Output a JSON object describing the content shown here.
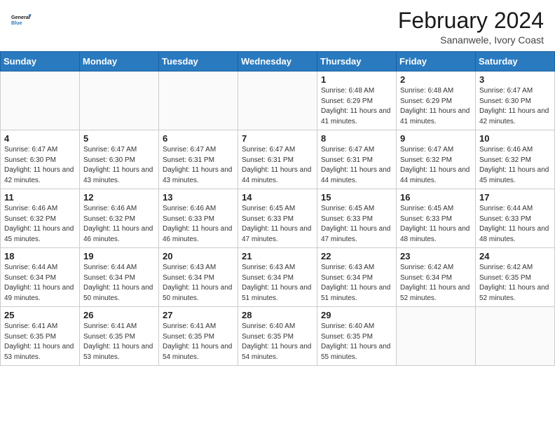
{
  "logo": {
    "line1": "General",
    "line2": "Blue"
  },
  "title": "February 2024",
  "subtitle": "Sananwele, Ivory Coast",
  "days_of_week": [
    "Sunday",
    "Monday",
    "Tuesday",
    "Wednesday",
    "Thursday",
    "Friday",
    "Saturday"
  ],
  "weeks": [
    [
      {
        "num": "",
        "info": ""
      },
      {
        "num": "",
        "info": ""
      },
      {
        "num": "",
        "info": ""
      },
      {
        "num": "",
        "info": ""
      },
      {
        "num": "1",
        "info": "Sunrise: 6:48 AM\nSunset: 6:29 PM\nDaylight: 11 hours and 41 minutes."
      },
      {
        "num": "2",
        "info": "Sunrise: 6:48 AM\nSunset: 6:29 PM\nDaylight: 11 hours and 41 minutes."
      },
      {
        "num": "3",
        "info": "Sunrise: 6:47 AM\nSunset: 6:30 PM\nDaylight: 11 hours and 42 minutes."
      }
    ],
    [
      {
        "num": "4",
        "info": "Sunrise: 6:47 AM\nSunset: 6:30 PM\nDaylight: 11 hours and 42 minutes."
      },
      {
        "num": "5",
        "info": "Sunrise: 6:47 AM\nSunset: 6:30 PM\nDaylight: 11 hours and 43 minutes."
      },
      {
        "num": "6",
        "info": "Sunrise: 6:47 AM\nSunset: 6:31 PM\nDaylight: 11 hours and 43 minutes."
      },
      {
        "num": "7",
        "info": "Sunrise: 6:47 AM\nSunset: 6:31 PM\nDaylight: 11 hours and 44 minutes."
      },
      {
        "num": "8",
        "info": "Sunrise: 6:47 AM\nSunset: 6:31 PM\nDaylight: 11 hours and 44 minutes."
      },
      {
        "num": "9",
        "info": "Sunrise: 6:47 AM\nSunset: 6:32 PM\nDaylight: 11 hours and 44 minutes."
      },
      {
        "num": "10",
        "info": "Sunrise: 6:46 AM\nSunset: 6:32 PM\nDaylight: 11 hours and 45 minutes."
      }
    ],
    [
      {
        "num": "11",
        "info": "Sunrise: 6:46 AM\nSunset: 6:32 PM\nDaylight: 11 hours and 45 minutes."
      },
      {
        "num": "12",
        "info": "Sunrise: 6:46 AM\nSunset: 6:32 PM\nDaylight: 11 hours and 46 minutes."
      },
      {
        "num": "13",
        "info": "Sunrise: 6:46 AM\nSunset: 6:33 PM\nDaylight: 11 hours and 46 minutes."
      },
      {
        "num": "14",
        "info": "Sunrise: 6:45 AM\nSunset: 6:33 PM\nDaylight: 11 hours and 47 minutes."
      },
      {
        "num": "15",
        "info": "Sunrise: 6:45 AM\nSunset: 6:33 PM\nDaylight: 11 hours and 47 minutes."
      },
      {
        "num": "16",
        "info": "Sunrise: 6:45 AM\nSunset: 6:33 PM\nDaylight: 11 hours and 48 minutes."
      },
      {
        "num": "17",
        "info": "Sunrise: 6:44 AM\nSunset: 6:33 PM\nDaylight: 11 hours and 48 minutes."
      }
    ],
    [
      {
        "num": "18",
        "info": "Sunrise: 6:44 AM\nSunset: 6:34 PM\nDaylight: 11 hours and 49 minutes."
      },
      {
        "num": "19",
        "info": "Sunrise: 6:44 AM\nSunset: 6:34 PM\nDaylight: 11 hours and 50 minutes."
      },
      {
        "num": "20",
        "info": "Sunrise: 6:43 AM\nSunset: 6:34 PM\nDaylight: 11 hours and 50 minutes."
      },
      {
        "num": "21",
        "info": "Sunrise: 6:43 AM\nSunset: 6:34 PM\nDaylight: 11 hours and 51 minutes."
      },
      {
        "num": "22",
        "info": "Sunrise: 6:43 AM\nSunset: 6:34 PM\nDaylight: 11 hours and 51 minutes."
      },
      {
        "num": "23",
        "info": "Sunrise: 6:42 AM\nSunset: 6:34 PM\nDaylight: 11 hours and 52 minutes."
      },
      {
        "num": "24",
        "info": "Sunrise: 6:42 AM\nSunset: 6:35 PM\nDaylight: 11 hours and 52 minutes."
      }
    ],
    [
      {
        "num": "25",
        "info": "Sunrise: 6:41 AM\nSunset: 6:35 PM\nDaylight: 11 hours and 53 minutes."
      },
      {
        "num": "26",
        "info": "Sunrise: 6:41 AM\nSunset: 6:35 PM\nDaylight: 11 hours and 53 minutes."
      },
      {
        "num": "27",
        "info": "Sunrise: 6:41 AM\nSunset: 6:35 PM\nDaylight: 11 hours and 54 minutes."
      },
      {
        "num": "28",
        "info": "Sunrise: 6:40 AM\nSunset: 6:35 PM\nDaylight: 11 hours and 54 minutes."
      },
      {
        "num": "29",
        "info": "Sunrise: 6:40 AM\nSunset: 6:35 PM\nDaylight: 11 hours and 55 minutes."
      },
      {
        "num": "",
        "info": ""
      },
      {
        "num": "",
        "info": ""
      }
    ]
  ]
}
